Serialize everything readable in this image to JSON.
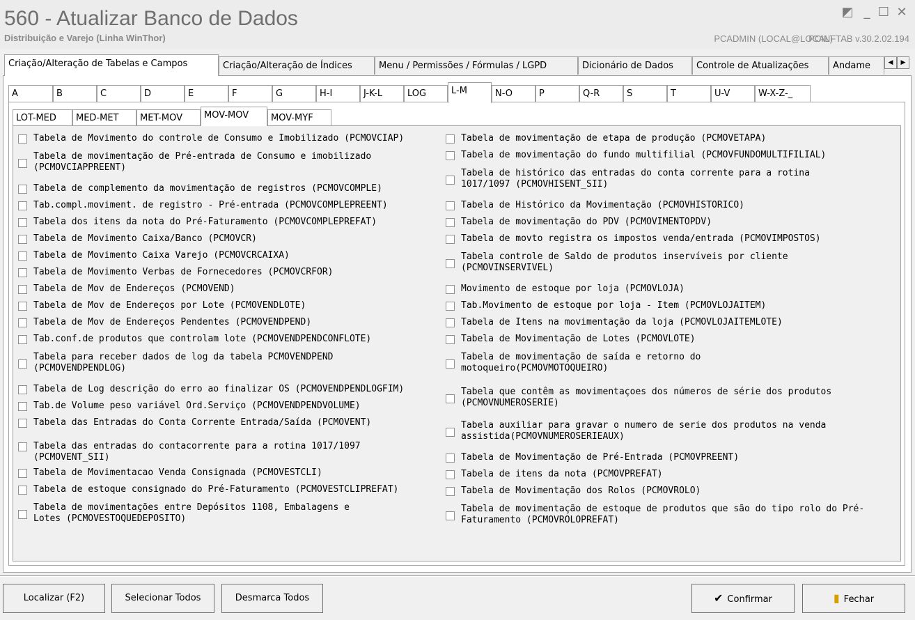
{
  "window": {
    "title": "560 - Atualizar Banco de Dados",
    "subtitle": "Distribuição e Varejo (Linha WinThor)",
    "user": "PCADMIN (LOCAL@LOCAL)",
    "version": "PCINFTAB  v.30.2.02.194"
  },
  "main_tabs": [
    "Criação/Alteração de Tabelas e Campos",
    "Criação/Alteração de Índices",
    "Menu / Permissões / Fórmulas / LGPD",
    "Dicionário de Dados",
    "Controle de Atualizações",
    "Andame"
  ],
  "letter_tabs": [
    "A",
    "B",
    "C",
    "D",
    "E",
    "F",
    "G",
    "H-I",
    "J-K-L",
    "LOG",
    "L-M",
    "N-O",
    "P",
    "Q-R",
    "S",
    "T",
    "U-V",
    "W-X-Z-_"
  ],
  "sub_tabs": [
    "LOT-MED",
    "MED-MET",
    "MET-MOV",
    "MOV-MOV",
    "MOV-MYF"
  ],
  "left_items": [
    "Tabela de Movimento do controle de Consumo e Imobilizado (PCMOVCIAP)",
    "Tabela de movimentação de Pré-entrada de Consumo e imobilizado (PCMOVCIAPPREENT)",
    "Tabela de complemento da movimentação de registros (PCMOVCOMPLE)",
    "Tab.compl.moviment. de registro - Pré-entrada (PCMOVCOMPLEPREENT)",
    "Tabela dos itens da nota do Pré-Faturamento (PCMOVCOMPLEPREFAT)",
    "Tabela de Movimento Caixa/Banco (PCMOVCR)",
    "Tabela de Movimento Caixa Varejo (PCMOVCRCAIXA)",
    "Tabela de Movimento Verbas de Fornecedores (PCMOVCRFOR)",
    "Tabela de Mov de Endereços (PCMOVEND)",
    "Tabela de Mov de Endereços por Lote (PCMOVENDLOTE)",
    "Tabela de Mov de Endereços Pendentes (PCMOVENDPEND)",
    "Tab.conf.de produtos que controlam lote (PCMOVENDPENDCONFLOTE)",
    "Tabela para receber dados de log da tabela PCMOVENDPEND (PCMOVENDPENDLOG)",
    "Tabela de Log descrição do erro ao finalizar OS (PCMOVENDPENDLOGFIM)",
    "Tab.de Volume peso variável Ord.Serviço (PCMOVENDPENDVOLUME)",
    "Tabela das Entradas do Conta Corrente Entrada/Saída (PCMOVENT)",
    "Tabela das entradas do contacorrente para a rotina 1017/1097 (PCMOVENT_SII)",
    "Tabela de Movimentacao Venda Consignada (PCMOVESTCLI)",
    "Tabela de estoque consignado do Pré-Faturamento (PCMOVESTCLIPREFAT)",
    "Tabela de movimentações entre Depósitos 1108, Embalagens e Lotes (PCMOVESTOQUEDEPOSITO)"
  ],
  "right_items": [
    "Tabela de movimentação de etapa de produção (PCMOVETAPA)",
    "Tabela de movimentação do fundo multifilial (PCMOVFUNDOMULTIFILIAL)",
    "Tabela de histórico das entradas do conta corrente para a rotina 1017/1097 (PCMOVHISENT_SII)",
    "Tabela de Histórico da Movimentação (PCMOVHISTORICO)",
    "Tabela de movimentação do PDV (PCMOVIMENTOPDV)",
    "Tabela de movto registra os impostos venda/entrada (PCMOVIMPOSTOS)",
    "Tabela controle de Saldo de produtos inservíveis por cliente (PCMOVINSERVIVEL)",
    "Movimento de estoque por loja (PCMOVLOJA)",
    "Tab.Movimento de estoque por loja - Item (PCMOVLOJAITEM)",
    "Tabela de Itens na movimentação da loja (PCMOVLOJAITEMLOTE)",
    "Tabela de Movimentação de Lotes (PCMOVLOTE)",
    "Tabela de movimentação de saída e retorno do motoqueiro(PCMOVMOTOQUEIRO)",
    "Tabela que contêm as movimentaçoes dos números de série dos produtos (PCMOVNUMEROSERIE)",
    "Tabela auxiliar para gravar o numero de serie dos produtos na venda assistida(PCMOVNUMEROSERIEAUX)",
    "Tabela de Movimentação de Pré-Entrada (PCMOVPREENT)",
    "Tabela de itens da nota (PCMOVPREFAT)",
    "Tabela de Movimentação dos Rolos (PCMOVROLO)",
    "Tabela de movimentação de estoque de produtos que são do tipo rolo do Pré-Faturamento (PCMOVROLOPREFAT)"
  ],
  "buttons": {
    "localizar": "Localizar (F2)",
    "selecionar": "Selecionar Todos",
    "desmarcar": "Desmarca Todos",
    "confirmar": "Confirmar",
    "fechar": "Fechar"
  }
}
